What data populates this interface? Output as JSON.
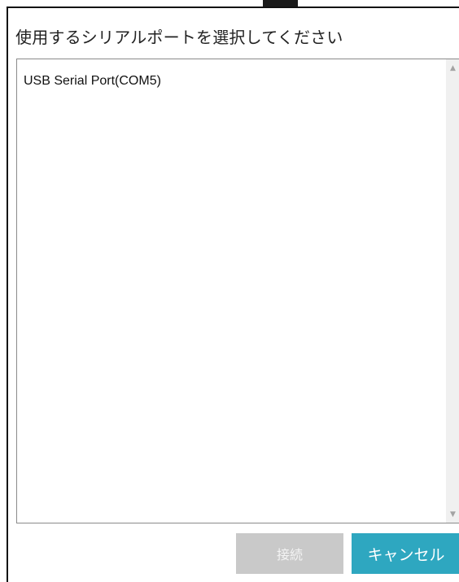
{
  "dialog": {
    "title": "使用するシリアルポートを選択してください"
  },
  "port_list": {
    "items": [
      {
        "label": "USB Serial Port(COM5)"
      }
    ],
    "scroll_up_icon": "▲",
    "scroll_down_icon": "▼"
  },
  "buttons": {
    "connect_label": "接続",
    "cancel_label": "キャンセル"
  },
  "colors": {
    "cancel_button": "#2ea7c0",
    "connect_button_disabled": "#c9c9c9"
  }
}
